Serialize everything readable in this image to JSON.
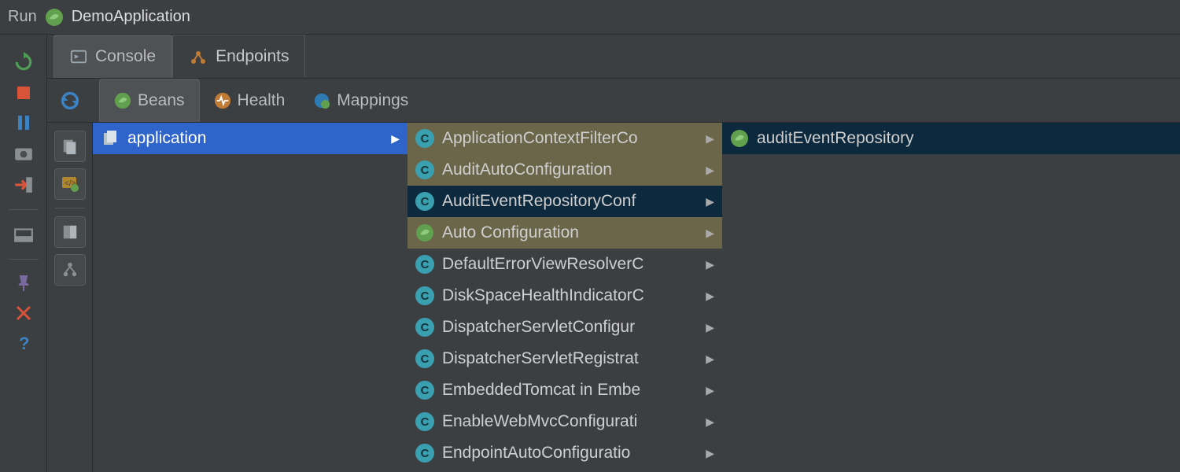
{
  "breadcrumb": {
    "run_label": "Run",
    "app_name": "DemoApplication"
  },
  "tabs": {
    "console": "Console",
    "endpoints": "Endpoints"
  },
  "subtabs": {
    "beans": "Beans",
    "health": "Health",
    "mappings": "Mappings"
  },
  "column1": {
    "items": [
      {
        "label": "application",
        "selected": true
      }
    ]
  },
  "column2": {
    "items": [
      {
        "label": "ApplicationContextFilterCo",
        "icon": "class",
        "sel": "olive"
      },
      {
        "label": "AuditAutoConfiguration",
        "icon": "class",
        "sel": "olive"
      },
      {
        "label": "AuditEventRepositoryConf",
        "icon": "class",
        "sel": "darksel"
      },
      {
        "label": "Auto Configuration",
        "icon": "spring",
        "sel": "olive"
      },
      {
        "label": "DefaultErrorViewResolverC",
        "icon": "class",
        "sel": "normal"
      },
      {
        "label": "DiskSpaceHealthIndicatorC",
        "icon": "class",
        "sel": "normal"
      },
      {
        "label": "DispatcherServletConfigur",
        "icon": "class",
        "sel": "normal"
      },
      {
        "label": "DispatcherServletRegistrat",
        "icon": "class",
        "sel": "normal"
      },
      {
        "label": "EmbeddedTomcat in Embe",
        "icon": "class",
        "sel": "normal"
      },
      {
        "label": "EnableWebMvcConfigurati",
        "icon": "class",
        "sel": "normal"
      },
      {
        "label": "EndpointAutoConfiguratio",
        "icon": "class",
        "sel": "normal"
      }
    ]
  },
  "column3": {
    "items": [
      {
        "label": "auditEventRepository",
        "icon": "spring",
        "sel": "darksel"
      }
    ]
  }
}
